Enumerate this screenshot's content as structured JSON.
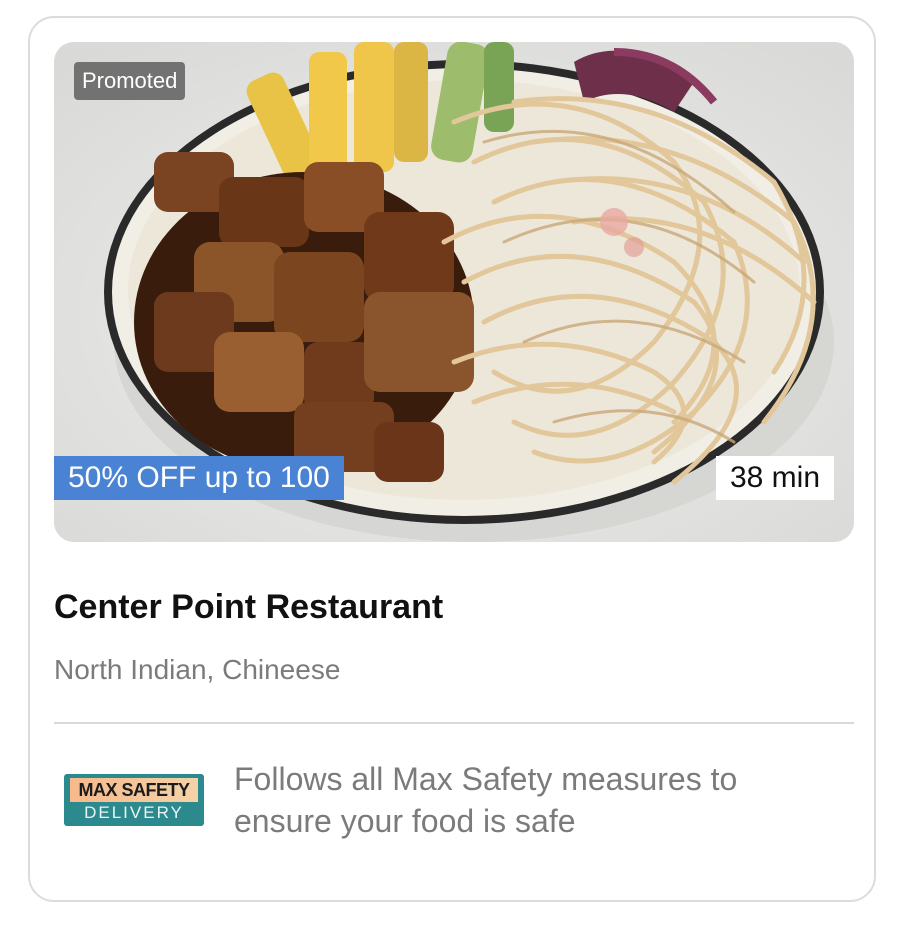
{
  "card": {
    "promoted_label": "Promoted",
    "offer_label": "50% OFF up to 100",
    "delivery_time": "38 min",
    "restaurant_name": "Center Point Restaurant",
    "cuisines": "North Indian, Chineese",
    "safety": {
      "badge_top": "MAX SAFETY",
      "badge_bottom": "DELIVERY",
      "message": "Follows all Max Safety measures to ensure your food is safe"
    }
  },
  "colors": {
    "offer_bg": "#4a83d3",
    "badge_teal": "#2c8a8e",
    "badge_peach": "#f6b98c",
    "muted_text": "#7b7b7b"
  },
  "icons": {
    "hero_image": "food-bowl-noodles-image",
    "safety_badge": "max-safety-delivery-badge"
  }
}
